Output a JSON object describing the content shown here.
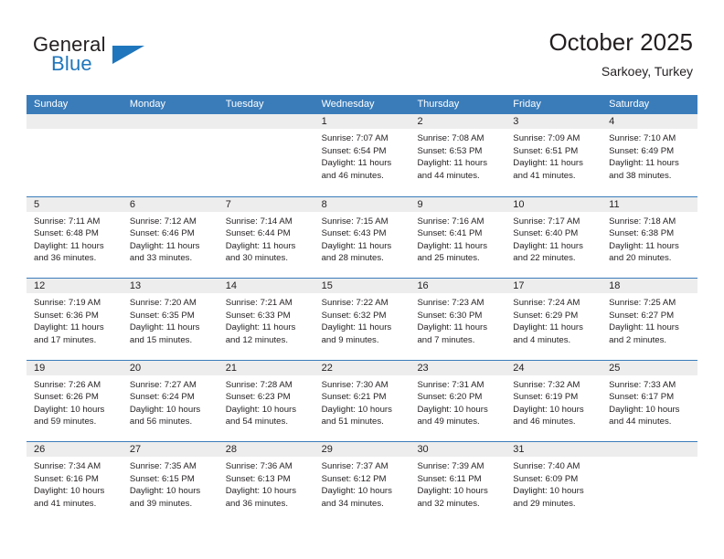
{
  "brand": {
    "name_part1": "General",
    "name_part2": "Blue",
    "flag_icon": "triangle-flag-icon"
  },
  "header": {
    "title": "October 2025",
    "location": "Sarkoey, Turkey"
  },
  "colors": {
    "header_blue": "#3a7cba",
    "brand_blue": "#1f76bc",
    "day_band_gray": "#ededed",
    "text": "#231f20"
  },
  "calendar": {
    "weekdays": [
      "Sunday",
      "Monday",
      "Tuesday",
      "Wednesday",
      "Thursday",
      "Friday",
      "Saturday"
    ],
    "labels": {
      "sunrise": "Sunrise:",
      "sunset": "Sunset:",
      "daylight": "Daylight:"
    },
    "weeks": [
      [
        {
          "day": "",
          "l1": "",
          "l2": "",
          "l3": "",
          "l4": ""
        },
        {
          "day": "",
          "l1": "",
          "l2": "",
          "l3": "",
          "l4": ""
        },
        {
          "day": "",
          "l1": "",
          "l2": "",
          "l3": "",
          "l4": ""
        },
        {
          "day": "1",
          "l1": "Sunrise: 7:07 AM",
          "l2": "Sunset: 6:54 PM",
          "l3": "Daylight: 11 hours",
          "l4": "and 46 minutes."
        },
        {
          "day": "2",
          "l1": "Sunrise: 7:08 AM",
          "l2": "Sunset: 6:53 PM",
          "l3": "Daylight: 11 hours",
          "l4": "and 44 minutes."
        },
        {
          "day": "3",
          "l1": "Sunrise: 7:09 AM",
          "l2": "Sunset: 6:51 PM",
          "l3": "Daylight: 11 hours",
          "l4": "and 41 minutes."
        },
        {
          "day": "4",
          "l1": "Sunrise: 7:10 AM",
          "l2": "Sunset: 6:49 PM",
          "l3": "Daylight: 11 hours",
          "l4": "and 38 minutes."
        }
      ],
      [
        {
          "day": "5",
          "l1": "Sunrise: 7:11 AM",
          "l2": "Sunset: 6:48 PM",
          "l3": "Daylight: 11 hours",
          "l4": "and 36 minutes."
        },
        {
          "day": "6",
          "l1": "Sunrise: 7:12 AM",
          "l2": "Sunset: 6:46 PM",
          "l3": "Daylight: 11 hours",
          "l4": "and 33 minutes."
        },
        {
          "day": "7",
          "l1": "Sunrise: 7:14 AM",
          "l2": "Sunset: 6:44 PM",
          "l3": "Daylight: 11 hours",
          "l4": "and 30 minutes."
        },
        {
          "day": "8",
          "l1": "Sunrise: 7:15 AM",
          "l2": "Sunset: 6:43 PM",
          "l3": "Daylight: 11 hours",
          "l4": "and 28 minutes."
        },
        {
          "day": "9",
          "l1": "Sunrise: 7:16 AM",
          "l2": "Sunset: 6:41 PM",
          "l3": "Daylight: 11 hours",
          "l4": "and 25 minutes."
        },
        {
          "day": "10",
          "l1": "Sunrise: 7:17 AM",
          "l2": "Sunset: 6:40 PM",
          "l3": "Daylight: 11 hours",
          "l4": "and 22 minutes."
        },
        {
          "day": "11",
          "l1": "Sunrise: 7:18 AM",
          "l2": "Sunset: 6:38 PM",
          "l3": "Daylight: 11 hours",
          "l4": "and 20 minutes."
        }
      ],
      [
        {
          "day": "12",
          "l1": "Sunrise: 7:19 AM",
          "l2": "Sunset: 6:36 PM",
          "l3": "Daylight: 11 hours",
          "l4": "and 17 minutes."
        },
        {
          "day": "13",
          "l1": "Sunrise: 7:20 AM",
          "l2": "Sunset: 6:35 PM",
          "l3": "Daylight: 11 hours",
          "l4": "and 15 minutes."
        },
        {
          "day": "14",
          "l1": "Sunrise: 7:21 AM",
          "l2": "Sunset: 6:33 PM",
          "l3": "Daylight: 11 hours",
          "l4": "and 12 minutes."
        },
        {
          "day": "15",
          "l1": "Sunrise: 7:22 AM",
          "l2": "Sunset: 6:32 PM",
          "l3": "Daylight: 11 hours",
          "l4": "and 9 minutes."
        },
        {
          "day": "16",
          "l1": "Sunrise: 7:23 AM",
          "l2": "Sunset: 6:30 PM",
          "l3": "Daylight: 11 hours",
          "l4": "and 7 minutes."
        },
        {
          "day": "17",
          "l1": "Sunrise: 7:24 AM",
          "l2": "Sunset: 6:29 PM",
          "l3": "Daylight: 11 hours",
          "l4": "and 4 minutes."
        },
        {
          "day": "18",
          "l1": "Sunrise: 7:25 AM",
          "l2": "Sunset: 6:27 PM",
          "l3": "Daylight: 11 hours",
          "l4": "and 2 minutes."
        }
      ],
      [
        {
          "day": "19",
          "l1": "Sunrise: 7:26 AM",
          "l2": "Sunset: 6:26 PM",
          "l3": "Daylight: 10 hours",
          "l4": "and 59 minutes."
        },
        {
          "day": "20",
          "l1": "Sunrise: 7:27 AM",
          "l2": "Sunset: 6:24 PM",
          "l3": "Daylight: 10 hours",
          "l4": "and 56 minutes."
        },
        {
          "day": "21",
          "l1": "Sunrise: 7:28 AM",
          "l2": "Sunset: 6:23 PM",
          "l3": "Daylight: 10 hours",
          "l4": "and 54 minutes."
        },
        {
          "day": "22",
          "l1": "Sunrise: 7:30 AM",
          "l2": "Sunset: 6:21 PM",
          "l3": "Daylight: 10 hours",
          "l4": "and 51 minutes."
        },
        {
          "day": "23",
          "l1": "Sunrise: 7:31 AM",
          "l2": "Sunset: 6:20 PM",
          "l3": "Daylight: 10 hours",
          "l4": "and 49 minutes."
        },
        {
          "day": "24",
          "l1": "Sunrise: 7:32 AM",
          "l2": "Sunset: 6:19 PM",
          "l3": "Daylight: 10 hours",
          "l4": "and 46 minutes."
        },
        {
          "day": "25",
          "l1": "Sunrise: 7:33 AM",
          "l2": "Sunset: 6:17 PM",
          "l3": "Daylight: 10 hours",
          "l4": "and 44 minutes."
        }
      ],
      [
        {
          "day": "26",
          "l1": "Sunrise: 7:34 AM",
          "l2": "Sunset: 6:16 PM",
          "l3": "Daylight: 10 hours",
          "l4": "and 41 minutes."
        },
        {
          "day": "27",
          "l1": "Sunrise: 7:35 AM",
          "l2": "Sunset: 6:15 PM",
          "l3": "Daylight: 10 hours",
          "l4": "and 39 minutes."
        },
        {
          "day": "28",
          "l1": "Sunrise: 7:36 AM",
          "l2": "Sunset: 6:13 PM",
          "l3": "Daylight: 10 hours",
          "l4": "and 36 minutes."
        },
        {
          "day": "29",
          "l1": "Sunrise: 7:37 AM",
          "l2": "Sunset: 6:12 PM",
          "l3": "Daylight: 10 hours",
          "l4": "and 34 minutes."
        },
        {
          "day": "30",
          "l1": "Sunrise: 7:39 AM",
          "l2": "Sunset: 6:11 PM",
          "l3": "Daylight: 10 hours",
          "l4": "and 32 minutes."
        },
        {
          "day": "31",
          "l1": "Sunrise: 7:40 AM",
          "l2": "Sunset: 6:09 PM",
          "l3": "Daylight: 10 hours",
          "l4": "and 29 minutes."
        },
        {
          "day": "",
          "l1": "",
          "l2": "",
          "l3": "",
          "l4": ""
        }
      ]
    ]
  }
}
